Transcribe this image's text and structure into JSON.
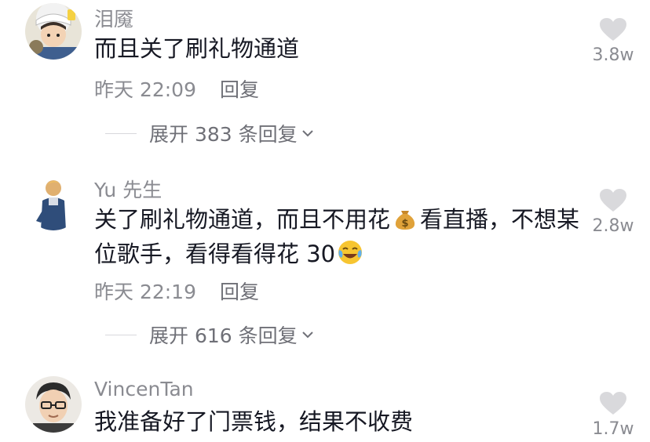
{
  "comments": [
    {
      "username": "泪魇",
      "text": "而且关了刷礼物通道",
      "time": "昨天 22:09",
      "reply_label": "回复",
      "expand_label": "展开 383 条回复",
      "likes": "3.8w",
      "avatar_icon": "avatar-cartoon-anime-boy"
    },
    {
      "username": "Yu 先生",
      "text_part1": "关了刷礼物通道，而且不用花",
      "emoji1": "money-bag-emoji",
      "text_part2": "看直播，不想某位歌手，看得看得花 30",
      "emoji2": "tears-of-joy-emoji",
      "time": "昨天 22:19",
      "reply_label": "回复",
      "expand_label": "展开 616 条回复",
      "likes": "2.8w",
      "avatar_icon": "avatar-person-blue"
    },
    {
      "username": "VincenTan",
      "text": "我准备好了门票钱，结果不收费",
      "likes": "1.7w",
      "avatar_icon": "avatar-man-glasses"
    }
  ],
  "colors": {
    "text": "#161823",
    "secondary": "#8a8b91",
    "heart": "#d9d9dc"
  }
}
